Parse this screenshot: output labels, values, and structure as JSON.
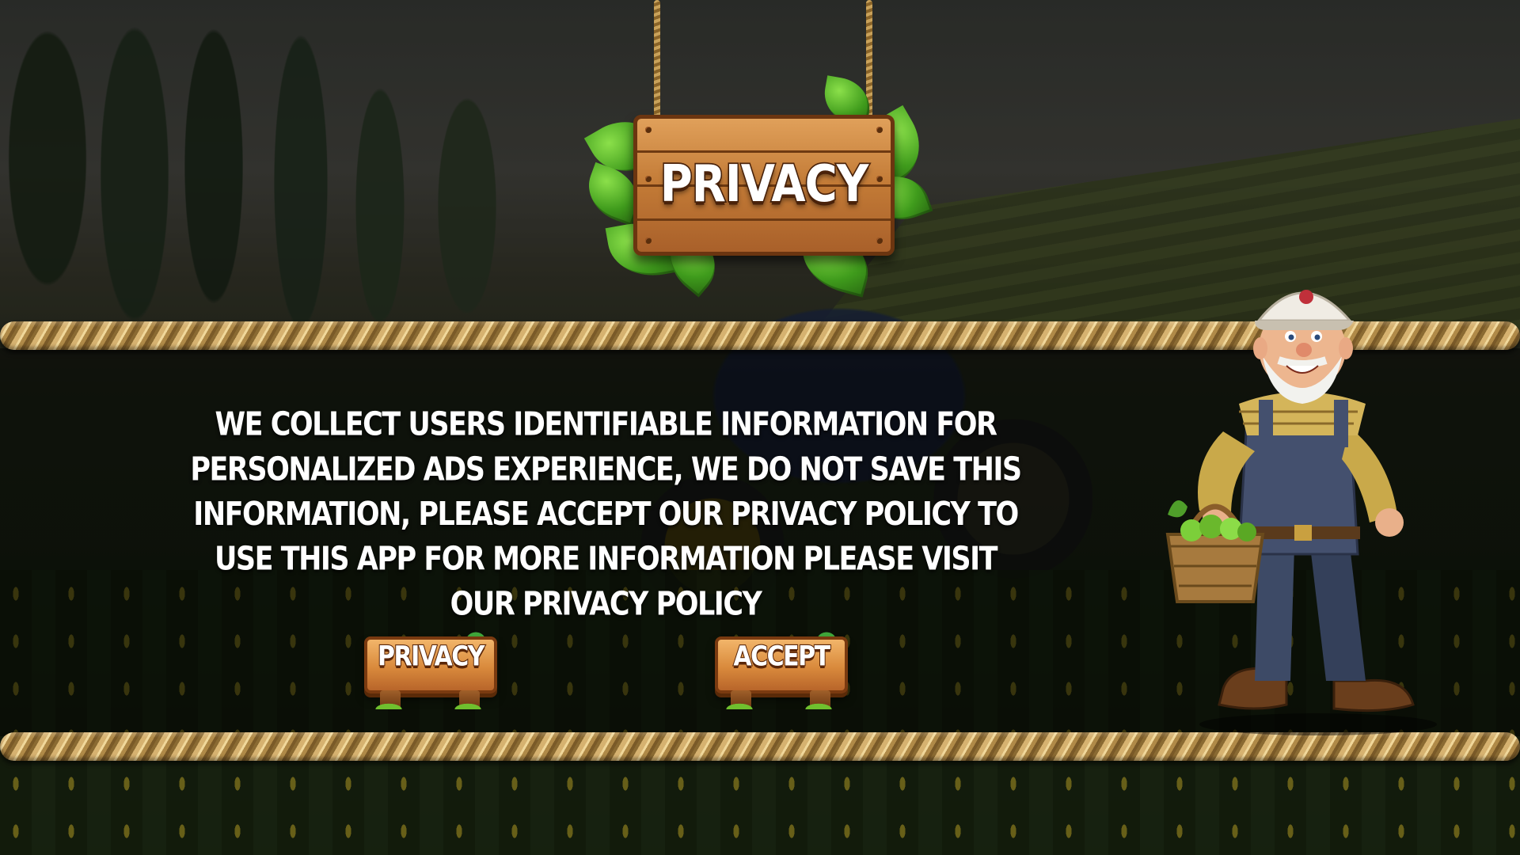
{
  "sign": {
    "title": "PRIVACY"
  },
  "message": {
    "text": "WE COLLECT USERS IDENTIFIABLE INFORMATION FOR PERSONALIZED ADS EXPERIENCE, WE DO NOT SAVE THIS INFORMATION, PLEASE ACCEPT OUR PRIVACY POLICY TO USE THIS APP FOR MORE INFORMATION PLEASE VISIT OUR PRIVACY POLICY"
  },
  "buttons": {
    "privacy_label": "PRIVACY",
    "accept_label": "ACCEPT"
  },
  "icons": {
    "sign": "wooden-sign",
    "character": "farmer-character",
    "basket": "vegetable-basket"
  },
  "colors": {
    "wood": "#d98a3c",
    "wood_dark": "#6b3510",
    "rope": "#d6b270",
    "text": "#ffffff",
    "leaf": "#3f9b1c"
  }
}
